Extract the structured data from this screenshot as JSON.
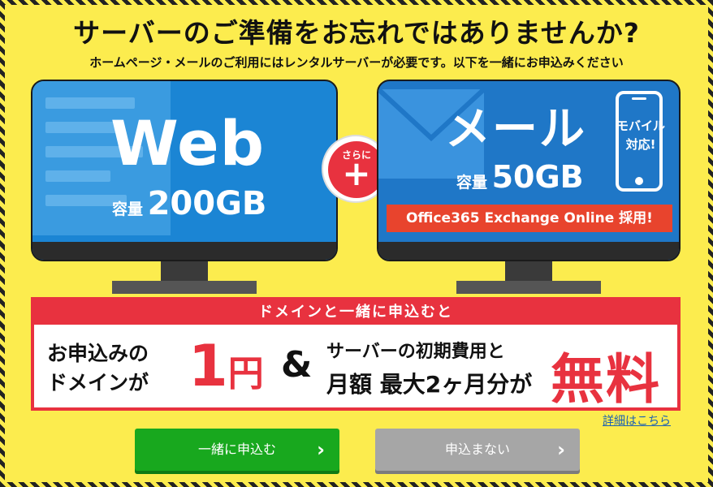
{
  "headline": "サーバーのご準備をお忘れではありませんか?",
  "subline": "ホームページ・メールのご利用にはレンタルサーバーが必要です。以下を一緒にお申込みください",
  "web": {
    "title": "Web",
    "capacity_label": "容量",
    "capacity_value": "200GB"
  },
  "plus": {
    "label": "さらに",
    "symbol": "+"
  },
  "mail": {
    "title": "メール",
    "capacity_label": "容量",
    "capacity_value": "50GB",
    "mobile_line1": "モバイル",
    "mobile_line2": "対応!",
    "banner": "Office365 Exchange Online 採用!"
  },
  "offer": {
    "header": "ドメインと一緒に申込むと",
    "left_line1": "お申込みの",
    "left_line2": "ドメインが",
    "price_number": "1",
    "price_unit": "円",
    "amp": "&",
    "right_line1": "サーバーの初期費用と",
    "right_line2": "月額 最大2ヶ月分が",
    "free": "無料"
  },
  "detail_link": "詳細はこちら",
  "buttons": {
    "apply": "一緒に申込む",
    "skip": "申込まない",
    "chevron": "›"
  },
  "colors": {
    "background_yellow": "#fcec4e",
    "accent_red": "#e8323f",
    "web_blue": "#1b85d4",
    "mail_blue": "#1f77c7",
    "apply_green": "#18a81e",
    "skip_gray": "#a6a6a6"
  }
}
